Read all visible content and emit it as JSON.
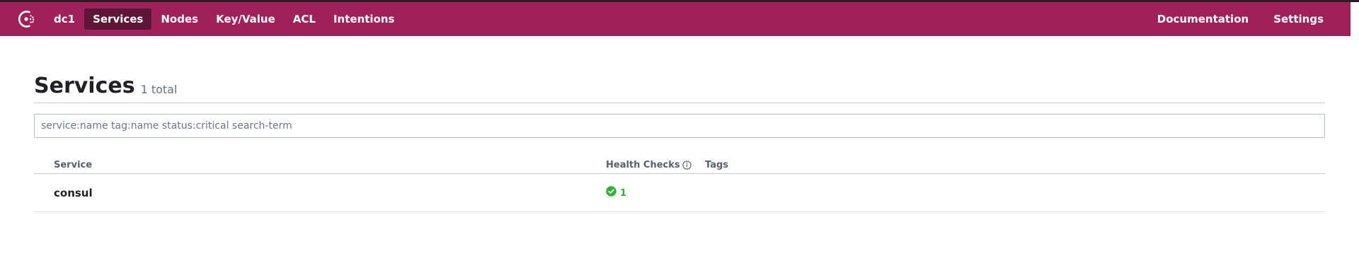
{
  "nav": {
    "logo_icon": "consul-logo-icon",
    "datacenter": "dc1",
    "items": [
      {
        "label": "Services",
        "active": true
      },
      {
        "label": "Nodes",
        "active": false
      },
      {
        "label": "Key/Value",
        "active": false
      },
      {
        "label": "ACL",
        "active": false
      },
      {
        "label": "Intentions",
        "active": false
      }
    ],
    "right": [
      {
        "label": "Documentation"
      },
      {
        "label": "Settings"
      }
    ],
    "colors": {
      "bar": "#a0205a",
      "active": "#5e1638"
    }
  },
  "page": {
    "title": "Services",
    "total": "1 total"
  },
  "search": {
    "placeholder": "service:name tag:name status:critical search-term",
    "value": ""
  },
  "table": {
    "headers": {
      "service": "Service",
      "health": "Health Checks",
      "tags": "Tags"
    },
    "rows": [
      {
        "service": "consul",
        "health_icon": "check-circle-icon",
        "health_count": "1",
        "health_color": "#2eb039",
        "tags": ""
      }
    ]
  }
}
